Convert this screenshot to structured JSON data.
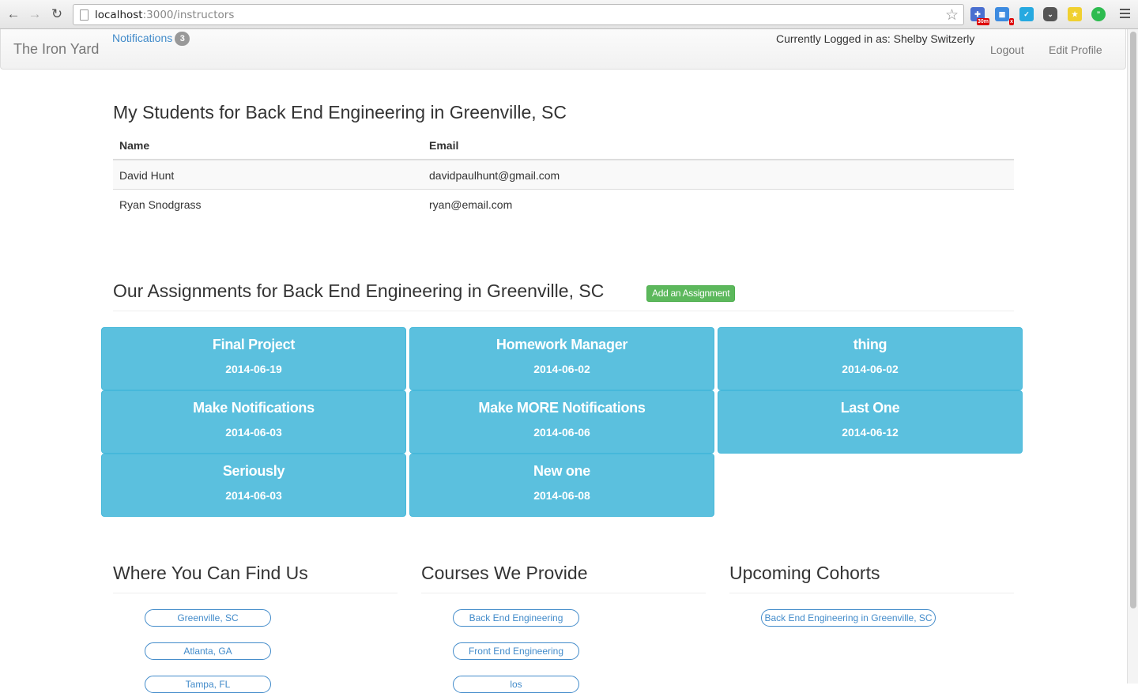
{
  "browser": {
    "url_host": "localhost",
    "url_path": ":3000/instructors",
    "ext_badge": "30m"
  },
  "navbar": {
    "brand": "The Iron Yard",
    "notifications_label": "Notifications",
    "notifications_count": "3",
    "logged_in_text": "Currently Logged in as: Shelby Switzerly",
    "logout": "Logout",
    "edit_profile": "Edit Profile"
  },
  "students": {
    "title": "My Students for Back End Engineering in Greenville, SC",
    "columns": [
      "Name",
      "Email"
    ],
    "rows": [
      {
        "name": "David Hunt",
        "email": "davidpaulhunt@gmail.com"
      },
      {
        "name": "Ryan Snodgrass",
        "email": "ryan@email.com"
      }
    ]
  },
  "assignments": {
    "title": "Our Assignments for Back End Engineering in Greenville, SC",
    "add_button": "Add an Assignment",
    "items": [
      {
        "title": "Final Project",
        "date": "2014-06-19"
      },
      {
        "title": "Homework Manager",
        "date": "2014-06-02"
      },
      {
        "title": "thing",
        "date": "2014-06-02"
      },
      {
        "title": "Make Notifications",
        "date": "2014-06-03"
      },
      {
        "title": "Make MORE Notifications",
        "date": "2014-06-06"
      },
      {
        "title": "Last One",
        "date": "2014-06-12"
      },
      {
        "title": "Seriously",
        "date": "2014-06-03"
      },
      {
        "title": "New one",
        "date": "2014-06-08"
      }
    ]
  },
  "footer": {
    "locations": {
      "title": "Where You Can Find Us",
      "items": [
        "Greenville, SC",
        "Atlanta, GA",
        "Tampa, FL"
      ]
    },
    "courses": {
      "title": "Courses We Provide",
      "items": [
        "Back End Engineering",
        "Front End Engineering",
        "los"
      ]
    },
    "cohorts": {
      "title": "Upcoming Cohorts",
      "items": [
        "Back End Engineering in Greenville, SC"
      ]
    }
  },
  "colors": {
    "card": "#5bc0de",
    "link": "#428bca",
    "success": "#5cb85c"
  }
}
